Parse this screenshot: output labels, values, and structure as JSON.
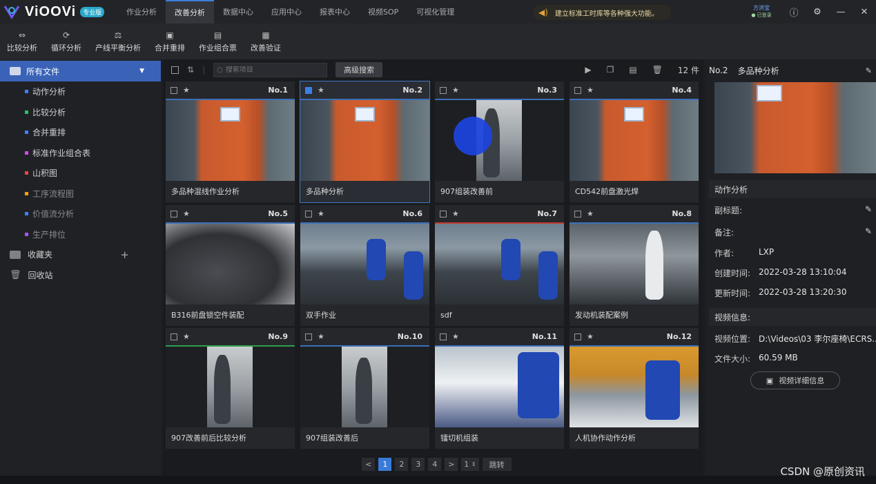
{
  "app": {
    "logo_text": "ViOOVi",
    "logo_badge": "专业版",
    "user_name": "方洪宝",
    "user_status": "● 已登录",
    "notice": "建立标准工时库等各种强大功能。"
  },
  "nav_tabs": [
    {
      "label": "作业分析",
      "active": false
    },
    {
      "label": "改善分析",
      "active": true
    },
    {
      "label": "数据中心",
      "active": false
    },
    {
      "label": "应用中心",
      "active": false
    },
    {
      "label": "报表中心",
      "active": false
    },
    {
      "label": "视频SOP",
      "active": false
    },
    {
      "label": "可视化管理",
      "active": false
    }
  ],
  "toolbar": [
    {
      "label": "比较分析",
      "icon": "compare-icon"
    },
    {
      "label": "循环分析",
      "icon": "cycle-icon"
    },
    {
      "label": "产线平衡分析",
      "icon": "balance-icon"
    },
    {
      "label": "合并重排",
      "icon": "merge-icon"
    },
    {
      "label": "作业组合票",
      "icon": "combo-icon"
    },
    {
      "label": "改善验证",
      "icon": "verify-icon"
    }
  ],
  "sidebar": {
    "all_files": "所有文件",
    "items": [
      {
        "label": "动作分析",
        "color": "#3b82f6",
        "dim": false
      },
      {
        "label": "比较分析",
        "color": "#22c55e",
        "dim": false
      },
      {
        "label": "合并重排",
        "color": "#3b82f6",
        "dim": false
      },
      {
        "label": "标准作业组合表",
        "color": "#d946ef",
        "dim": false
      },
      {
        "label": "山积图",
        "color": "#ef4444",
        "dim": false
      },
      {
        "label": "工序流程图",
        "color": "#f59e0b",
        "dim": true
      },
      {
        "label": "价值流分析",
        "color": "#3b82f6",
        "dim": true
      },
      {
        "label": "生产排位",
        "color": "#a855f7",
        "dim": true
      }
    ],
    "favorites": "收藏夹",
    "recycle": "回收站"
  },
  "main": {
    "search_placeholder": "搜索项目",
    "advanced_search": "高级搜索",
    "count": "12 件"
  },
  "cards": [
    {
      "no": "No.1",
      "title": "多品种混线作业分析",
      "checked": false,
      "line": "#3b6fb8"
    },
    {
      "no": "No.2",
      "title": "多品种分析",
      "checked": true,
      "line": "#3b6fb8"
    },
    {
      "no": "No.3",
      "title": "907组装改善前",
      "checked": false,
      "line": "#3b6fb8"
    },
    {
      "no": "No.4",
      "title": "CD542前盘激光焊",
      "checked": false,
      "line": "#3b6fb8"
    },
    {
      "no": "No.5",
      "title": "B316前盘锁空件装配",
      "checked": false,
      "line": "#3b6fb8"
    },
    {
      "no": "No.6",
      "title": "双手作业",
      "checked": false,
      "line": "#3b6fb8"
    },
    {
      "no": "No.7",
      "title": "sdf",
      "checked": false,
      "line": "#c0392b"
    },
    {
      "no": "No.8",
      "title": "发动机装配案例",
      "checked": false,
      "line": "#3b6fb8"
    },
    {
      "no": "No.9",
      "title": "907改善前后比较分析",
      "checked": false,
      "line": "#2e9e4f"
    },
    {
      "no": "No.10",
      "title": "907组装改善后",
      "checked": false,
      "line": "#3b6fb8"
    },
    {
      "no": "No.11",
      "title": "镭切机组装",
      "checked": false,
      "line": "#3b6fb8"
    },
    {
      "no": "No.12",
      "title": "人机协作动作分析",
      "checked": false,
      "line": "#3b6fb8"
    }
  ],
  "pagination": {
    "prev": "<",
    "pages": [
      "1",
      "2",
      "3",
      "4"
    ],
    "next": ">",
    "page_input": "1",
    "jump": "跳转",
    "current": "1"
  },
  "detail": {
    "no": "No.2",
    "title": "多品种分析",
    "section_analysis": "动作分析",
    "subtitle_key": "副标题:",
    "note_key": "备注:",
    "author_key": "作者:",
    "author": "LXP",
    "created_key": "创建时间:",
    "created": "2022-03-28 13:10:04",
    "updated_key": "更新时间:",
    "updated": "2022-03-28 13:20:30",
    "section_video": "视频信息:",
    "location_key": "视频位置:",
    "location": "D:\\Videos\\03 李尔座椅\\ECRS...",
    "size_key": "文件大小:",
    "size": "60.59 MB",
    "detail_button": "视频详细信息"
  },
  "watermark": "CSDN @原创资讯",
  "colors": {
    "accent": "#3a7ad8",
    "sidebar_active": "#3a63b8"
  }
}
